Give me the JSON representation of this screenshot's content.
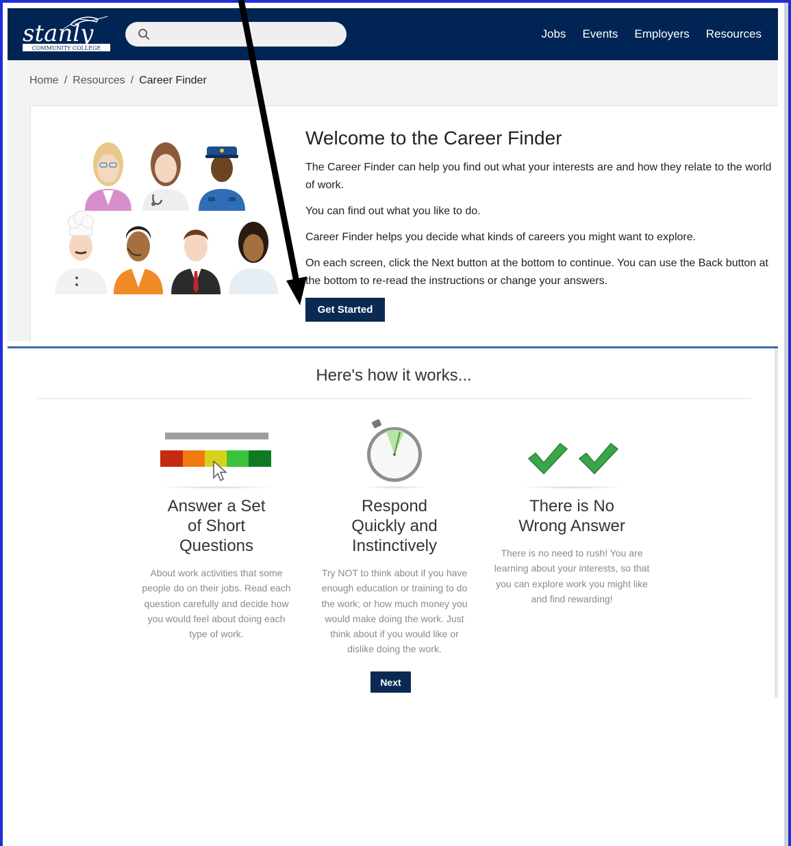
{
  "header": {
    "logo_alt": "Stanly Community College",
    "logo_text": "stanly",
    "logo_subtext": "COMMUNITY COLLEGE",
    "search": {
      "placeholder": "",
      "value": ""
    },
    "nav": [
      "Jobs",
      "Events",
      "Employers",
      "Resources"
    ]
  },
  "breadcrumb": {
    "items": [
      "Home",
      "Resources"
    ],
    "separator": "/",
    "current": "Career Finder"
  },
  "welcome": {
    "title": "Welcome to the Career Finder",
    "paragraphs": [
      "The Career Finder can help you find out what your interests are and how they relate to the world of work.",
      "You can find out what you like to do.",
      "Career Finder helps you decide what kinds of careers you might want to explore.",
      "On each screen, click the Next button at the bottom to continue. You can use the Back button at the bottom to re-read the instructions or change your answers."
    ],
    "button": "Get Started"
  },
  "how_it_works": {
    "title": "Here's how it works...",
    "steps": [
      {
        "icon": "rating-scale-icon",
        "title_lines": [
          "Answer a Set",
          "of Short",
          "Questions"
        ],
        "text": "About work activities that some people do on their jobs. Read each question carefully and decide how you would feel about doing each type of work."
      },
      {
        "icon": "stopwatch-icon",
        "title_lines": [
          "Respond",
          "Quickly and",
          "Instinctively"
        ],
        "text": "Try NOT to think about if you have enough education or training to do the work; or how much money you would make doing the work. Just think about if you would like or dislike doing the work."
      },
      {
        "icon": "checkmarks-icon",
        "title_lines": [
          "There is No",
          "Wrong Answer"
        ],
        "text": "There is no need to rush! You are learning about your interests, so that you can explore work you might like and find rewarding!"
      }
    ],
    "next_button": "Next"
  },
  "colors": {
    "navy": "#002554",
    "button": "#0a2a53",
    "divider": "#3a6aa6",
    "frame": "#1f2ed6",
    "check_green": "#3aa64a"
  }
}
